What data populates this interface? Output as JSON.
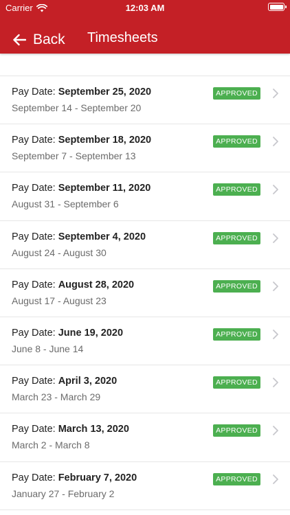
{
  "status_bar": {
    "carrier": "Carrier",
    "time": "12:03 AM"
  },
  "nav": {
    "back_label": "Back",
    "title": "Timesheets"
  },
  "colors": {
    "header": "#c42026",
    "approved": "#4caf50"
  },
  "icons": {
    "back": "arrow-left-icon",
    "row": "chevron-right-icon"
  },
  "list": {
    "rows": [
      {
        "prefix": "Pay Date: ",
        "date": "September 25, 2020",
        "range": "September 14 - September 20",
        "status": "APPROVED"
      },
      {
        "prefix": "Pay Date: ",
        "date": "September 18, 2020",
        "range": "September 7 - September 13",
        "status": "APPROVED"
      },
      {
        "prefix": "Pay Date: ",
        "date": "September 11, 2020",
        "range": "August 31 - September 6",
        "status": "APPROVED"
      },
      {
        "prefix": "Pay Date: ",
        "date": "September 4, 2020",
        "range": "August 24 - August 30",
        "status": "APPROVED"
      },
      {
        "prefix": "Pay Date: ",
        "date": "August 28, 2020",
        "range": "August 17 - August 23",
        "status": "APPROVED"
      },
      {
        "prefix": "Pay Date: ",
        "date": "June 19, 2020",
        "range": "June 8 - June 14",
        "status": "APPROVED"
      },
      {
        "prefix": "Pay Date: ",
        "date": "April 3, 2020",
        "range": "March 23 - March 29",
        "status": "APPROVED"
      },
      {
        "prefix": "Pay Date: ",
        "date": "March 13, 2020",
        "range": "March 2 - March 8",
        "status": "APPROVED"
      },
      {
        "prefix": "Pay Date: ",
        "date": "February 7, 2020",
        "range": "January 27 - February 2",
        "status": "APPROVED"
      }
    ]
  }
}
